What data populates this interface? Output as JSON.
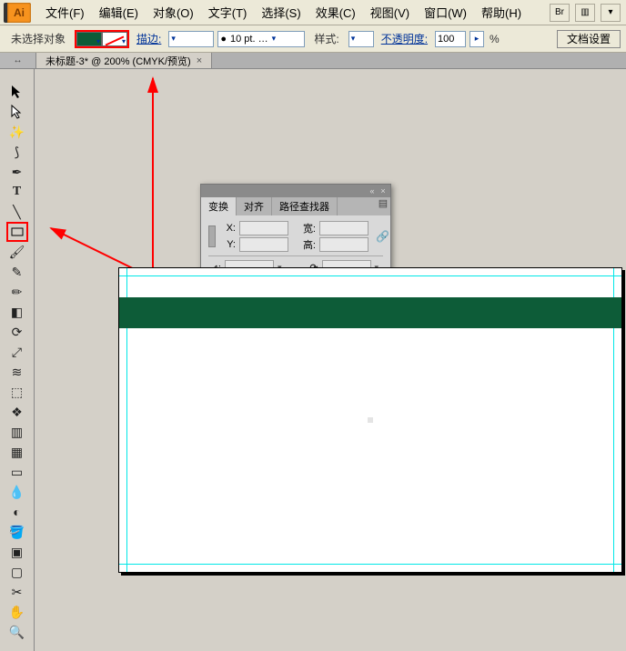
{
  "app": {
    "logo_text": "Ai"
  },
  "menu": {
    "file": "文件(F)",
    "edit": "编辑(E)",
    "object": "对象(O)",
    "type": "文字(T)",
    "select": "选择(S)",
    "effect": "效果(C)",
    "view": "视图(V)",
    "window": "窗口(W)",
    "help": "帮助(H)"
  },
  "options": {
    "no_selection": "未选择对象",
    "stroke_label": "描边:",
    "stroke_weight": "10 pt. …",
    "style_label": "样式:",
    "opacity_label": "不透明度:",
    "opacity_value": "100",
    "opacity_unit": "%",
    "doc_setup": "文档设置"
  },
  "document": {
    "tab_title": "未标题-3* @ 200% (CMYK/预览)",
    "tab_close": "×"
  },
  "panel": {
    "tabs": {
      "transform": "变换",
      "align": "对齐",
      "pathfinder": "路径查找器"
    },
    "x_label": "X:",
    "y_label": "Y:",
    "w_label": "宽:",
    "h_label": "高:",
    "x_val": "",
    "y_val": "",
    "w_val": "",
    "h_val": "",
    "shear_label": "⊿:",
    "rotate_label": "⟳"
  },
  "colors": {
    "fill": "#0d5c38",
    "band": "#0d5c38",
    "highlight": "#ff0000"
  }
}
